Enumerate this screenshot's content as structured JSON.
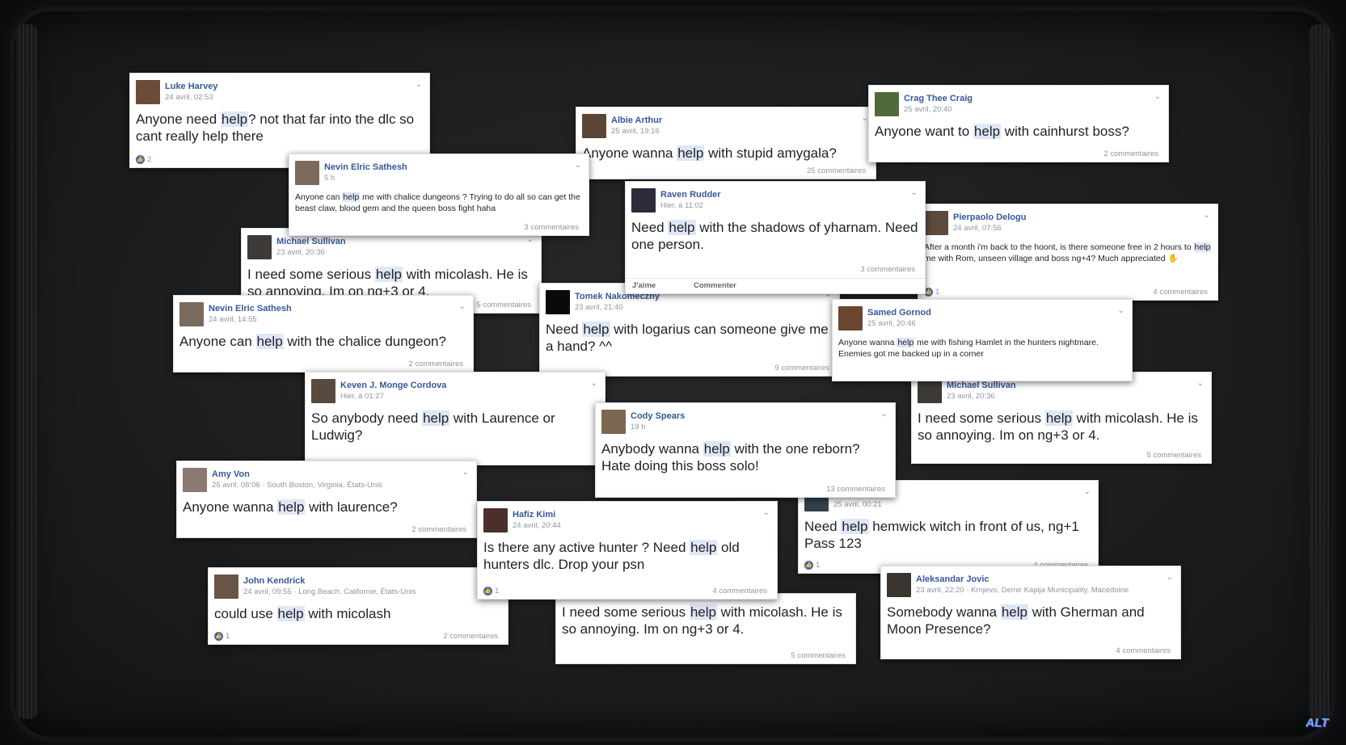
{
  "posts": [
    {
      "name": "Luke Harvey",
      "meta": "24 avril, 02:53",
      "pre": "Anyone need ",
      "hl": "help",
      "post": "? not that far into the dlc so cant really help there",
      "likes": "2",
      "comments": "",
      "avatar": "#6b4b3a"
    },
    {
      "name": "Nevin Elric Sathesh",
      "meta": "5 h",
      "pre": "Anyone can ",
      "hl": "help",
      "post": " me with chalice dungeons ? Trying to do all so can get the beast claw, blood gem and the queen boss fight haha",
      "likes": "",
      "comments": "3 commentaires",
      "avatar": "#7a6a5c"
    },
    {
      "name": "Michael Sullivan",
      "meta": "23 avril, 20:36",
      "pre": "I need some serious ",
      "hl": "help",
      "post": " with micolash. He is so annoying. Im on ng+3 or 4.",
      "likes": "",
      "comments": "5 commentaires",
      "avatar": "#3d3a38"
    },
    {
      "name": "Nevin Elric Sathesh",
      "meta": "24 avril, 14:55",
      "pre": "Anyone can ",
      "hl": "help",
      "post": " with the chalice dungeon?",
      "likes": "",
      "comments": "2 commentaires",
      "avatar": "#7a6a5c"
    },
    {
      "name": "Albie Arthur",
      "meta": "25 avril, 19:16",
      "pre": "Anyone wanna ",
      "hl": "help",
      "post": " with stupid amygala?",
      "likes": "",
      "comments": "25 commentaires",
      "avatar": "#5a4636"
    },
    {
      "name": "Crag Thee Craig",
      "meta": "25 avril, 20:40",
      "pre": "Anyone want to ",
      "hl": "help",
      "post": " with cainhurst boss?",
      "likes": "",
      "comments": "2 commentaires",
      "avatar": "#4f6b3b"
    },
    {
      "name": "Raven Rudder",
      "meta": "Hier, à 11:02",
      "pre": "Need ",
      "hl": "help",
      "post": " with the shadows of yharnam. Need one person.",
      "likes": "",
      "comments": "3 commentaires",
      "avatar": "#2b2b3a",
      "like_action": "J'aime",
      "comment_action": "Commenter"
    },
    {
      "name": "Pierpaolo Delogu",
      "meta": "24 avril, 07:56",
      "pre": "After a month i'm back to the hoont, is there someone free in 2 hours to ",
      "hl": "help",
      "post": " me with Rom, unseen village and boss ng+4? Much appreciated ✋",
      "likes": "1",
      "comments": "4 commentaires",
      "avatar": "#5c4a3c"
    },
    {
      "name": "Tomek Nakomeczny",
      "meta": "23 avril, 21:40",
      "pre": "Need ",
      "hl": "help",
      "post": " with logarius can someone give me a hand? ^^",
      "likes": "",
      "comments": "9 commentaires",
      "avatar": "#0a0a0a"
    },
    {
      "name": "Samed Gornod",
      "meta": "25 avril, 20:46",
      "pre": "Anyone wanna ",
      "hl": "help",
      "post": " me with fishing Hamlet in the hunters nightmare. Enemies got me backed up in a corner",
      "likes": "",
      "comments": "",
      "avatar": "#6b4630"
    },
    {
      "name": "Keven J. Monge Cordova",
      "meta": "Hier, à 01:27",
      "pre": "So anybody need ",
      "hl": "help",
      "post": " with Laurence or Ludwig?",
      "likes": "",
      "comments": "",
      "avatar": "#594a40"
    },
    {
      "name": "Michael Sullivan",
      "meta": "23 avril, 20:36",
      "pre": "I need some serious ",
      "hl": "help",
      "post": " with micolash. He is so annoying. Im on ng+3 or 4.",
      "likes": "",
      "comments": "5 commentaires",
      "avatar": "#3d3a38"
    },
    {
      "name": "Cody Spears",
      "meta": "19 h",
      "pre": "Anybody wanna ",
      "hl": "help",
      "post": " with the one reborn? Hate doing this boss solo!",
      "likes": "",
      "comments": "13 commentaires",
      "avatar": "#7d6650"
    },
    {
      "name": "Amy Von",
      "meta": "25 avril, 08:06 · South Boston, Virginia, États-Unis",
      "pre": "Anyone wanna ",
      "hl": "help",
      "post": " with laurence?",
      "likes": "",
      "comments": "2 commentaires",
      "avatar": "#8a7a70"
    },
    {
      "name": "",
      "meta": "25 avril, 00:21",
      "pre": "Need ",
      "hl": "help",
      "post": " hemwick witch in front of us, ng+1 Pass 123",
      "likes": "1",
      "comments": "4 commentaires",
      "avatar": "#34404a"
    },
    {
      "name": "Hafiz Kimi",
      "meta": "24 avril, 20:44",
      "pre": "Is there any active hunter ? Need ",
      "hl": "help",
      "post": " old hunters dlc. Drop your psn",
      "likes": "1",
      "comments": "4 commentaires",
      "avatar": "#4a2f2a"
    },
    {
      "name": "John Kendrick",
      "meta": "24 avril, 09:55 · Long Beach, Californie, États-Unis",
      "pre": "could use ",
      "hl": "help",
      "post": " with micolash",
      "likes": "1",
      "comments": "2 commentaires",
      "avatar": "#6a5445"
    },
    {
      "name": "",
      "meta": "",
      "pre": "I need some serious ",
      "hl": "help",
      "post": " with micolash. He is so annoying. Im on ng+3 or 4.",
      "likes": "",
      "comments": "5 commentaires",
      "avatar": ""
    },
    {
      "name": "Aleksandar Jovic",
      "meta": "23 avril, 22:20 · Krnjevo, Demir Kapija Municipality, Macédoine",
      "pre": "Somebody wanna ",
      "hl": "help",
      "post": " with Gherman and Moon Presence?",
      "likes": "",
      "comments": "4 commentaires",
      "avatar": "#3b3530"
    }
  ],
  "logo": "ALT"
}
